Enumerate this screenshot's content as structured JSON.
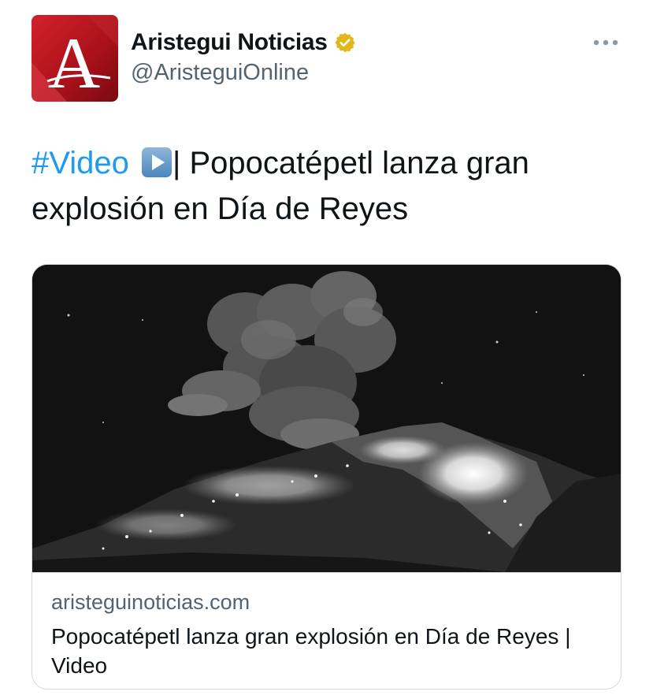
{
  "author": {
    "display_name": "Aristegui Noticias",
    "handle": "@AristeguiOnline",
    "avatar_letter": "A",
    "verified": true,
    "avatar_color": "#b3141c",
    "badge_color": "#e2b719"
  },
  "tweet": {
    "hashtag": "#Video",
    "emoji": "play-button-icon",
    "text": "| Popocatépetl lanza gran explosión en Día de Reyes"
  },
  "card": {
    "domain": "aristeguinoticias.com",
    "title": "Popocatépetl lanza gran explosión en Día de Reyes | Video",
    "image": "volcano-eruption-night-photo"
  },
  "icons": {
    "more": "more-options-icon",
    "verified": "verified-badge-icon"
  },
  "colors": {
    "link": "#1d9bf0",
    "secondary_text": "#536471",
    "border": "#cfd9de"
  }
}
